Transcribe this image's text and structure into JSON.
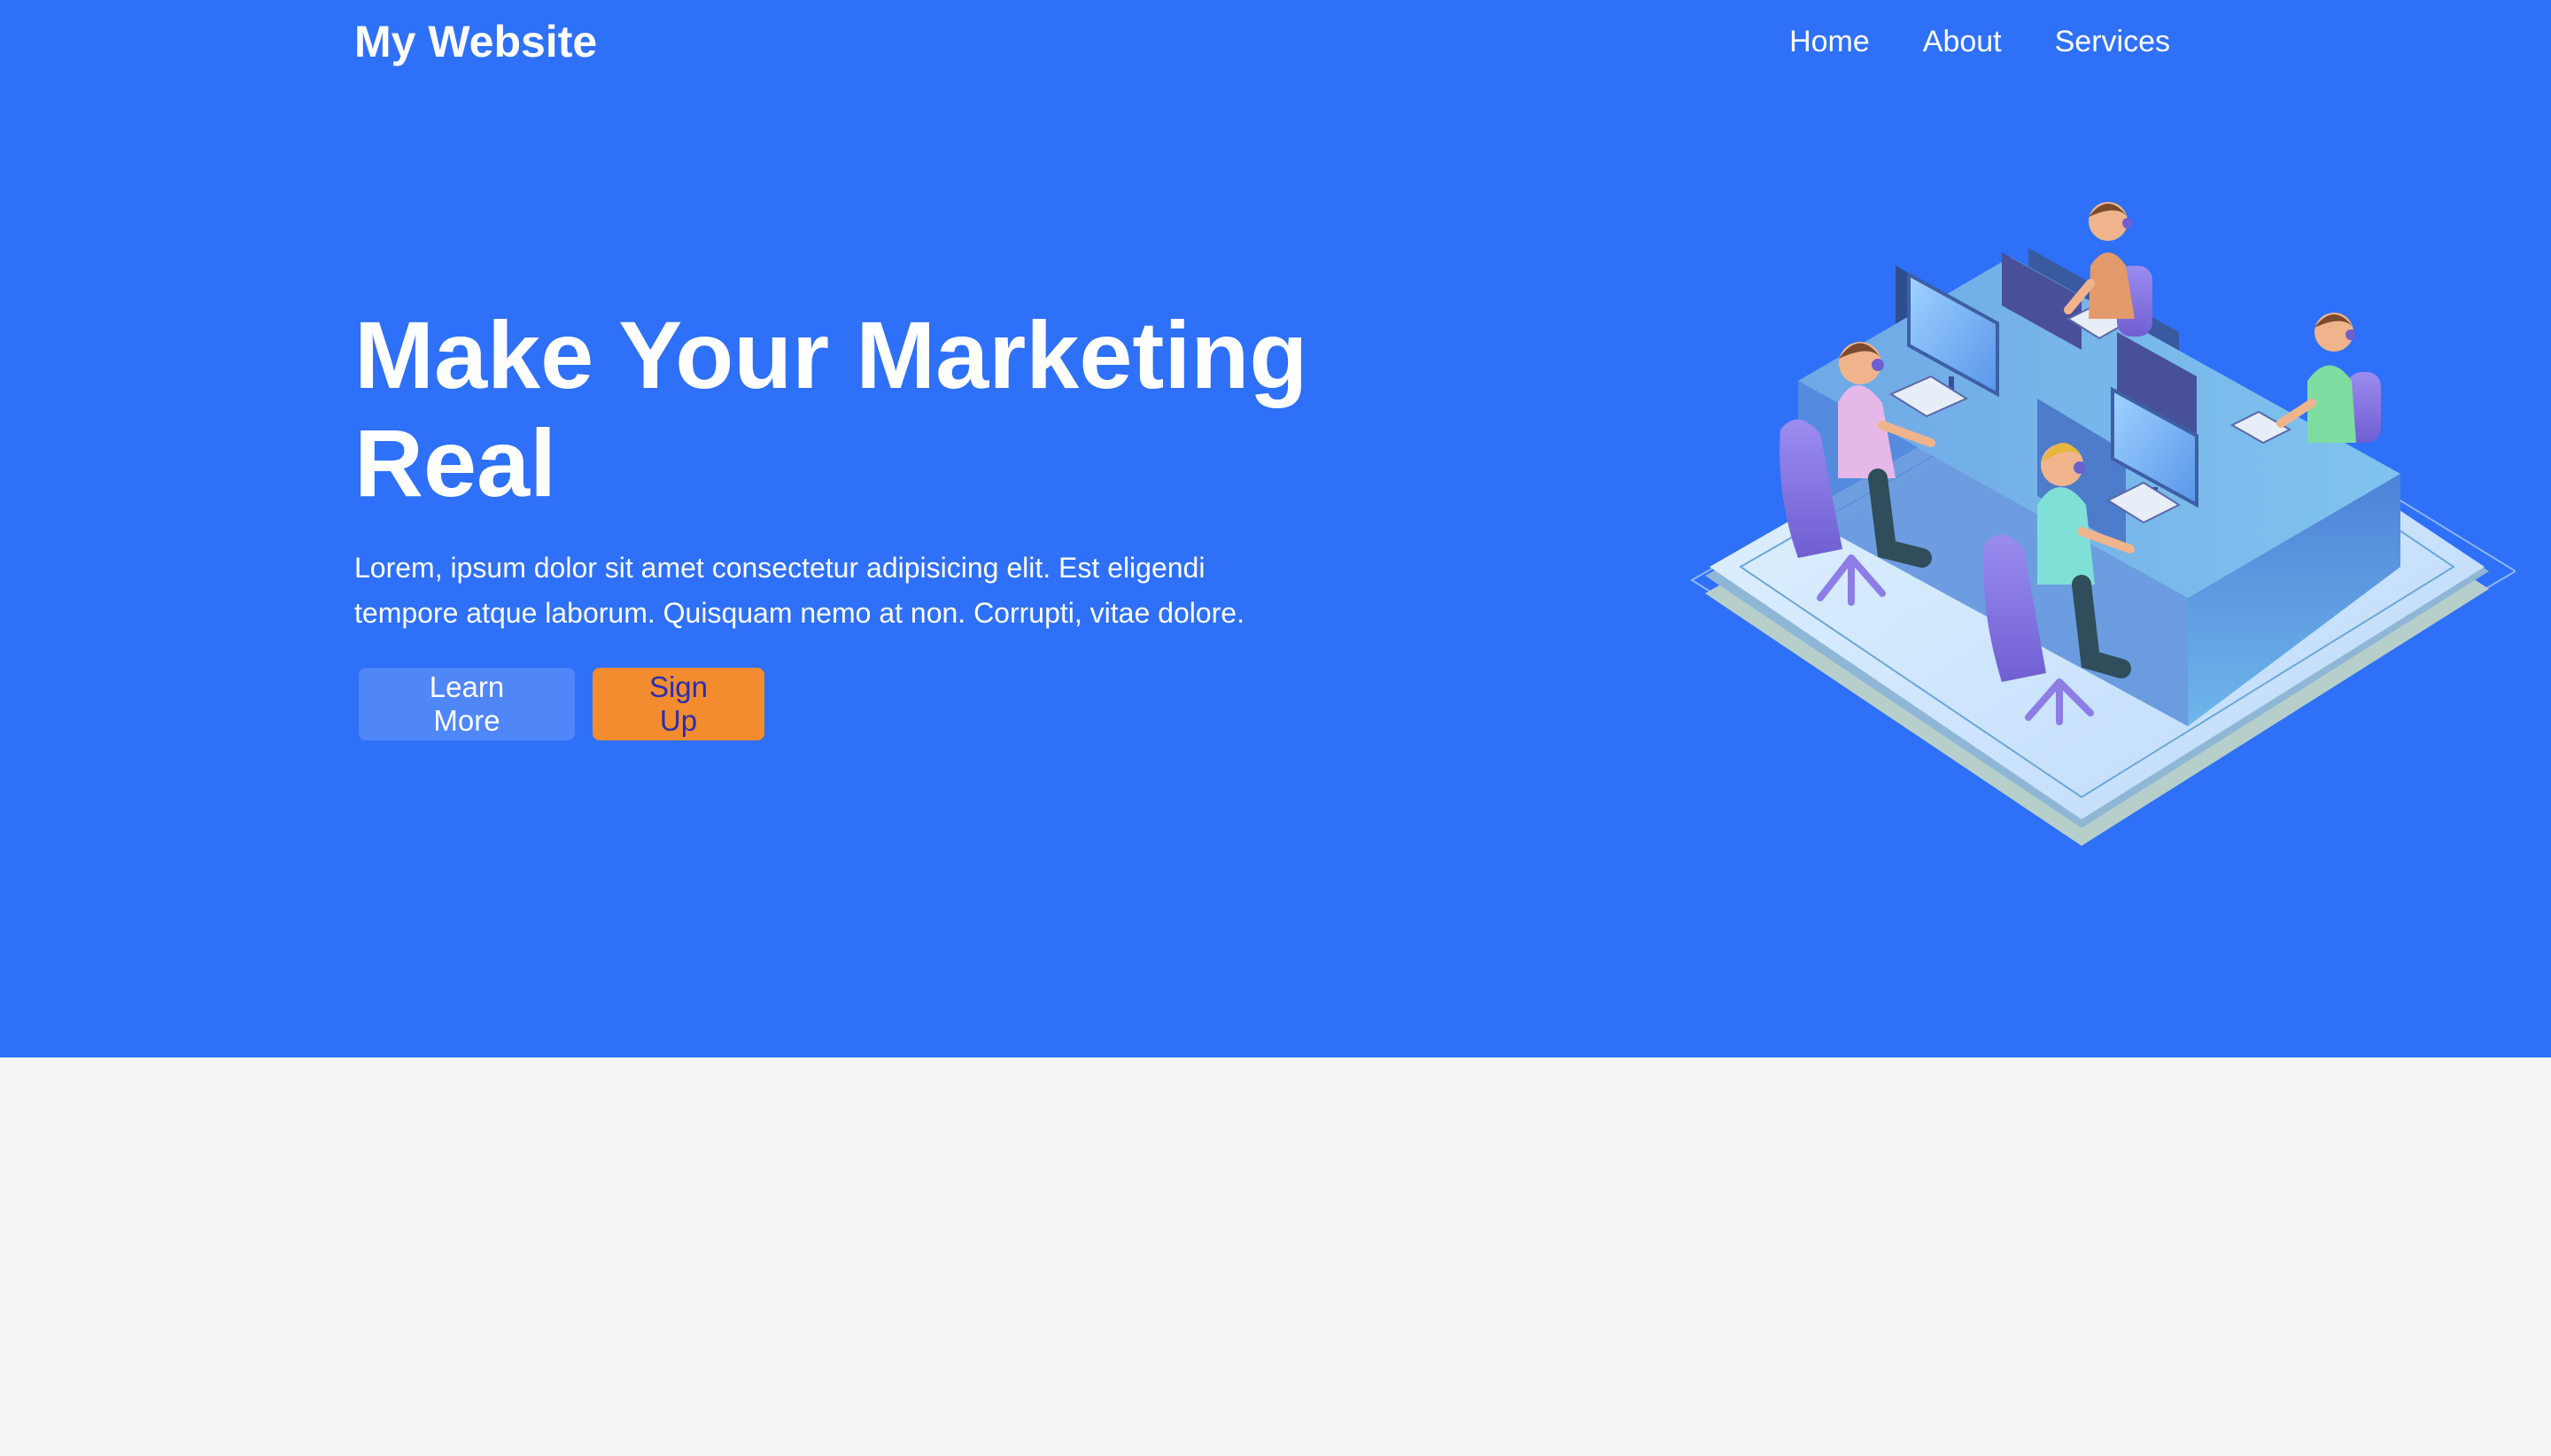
{
  "brand": {
    "title": "My Website"
  },
  "nav": {
    "items": [
      {
        "label": "Home"
      },
      {
        "label": "About"
      },
      {
        "label": "Services"
      }
    ]
  },
  "hero": {
    "title": "Make Your Marketing Real",
    "text": "Lorem, ipsum dolor sit amet consectetur adipisicing elit. Est eligendi tempore atque laborum. Quisquam nemo at non. Corrupti, vitae dolore.",
    "buttons": {
      "learn_more": "Learn More",
      "sign_up": "Sign Up"
    }
  },
  "colors": {
    "hero_bg": "#2e70f7",
    "learn_more_bg": "#4f86f8",
    "sign_up_bg": "#f28c2e",
    "sign_up_text": "#2b2fb0",
    "page_bg": "#f4f4f4"
  }
}
